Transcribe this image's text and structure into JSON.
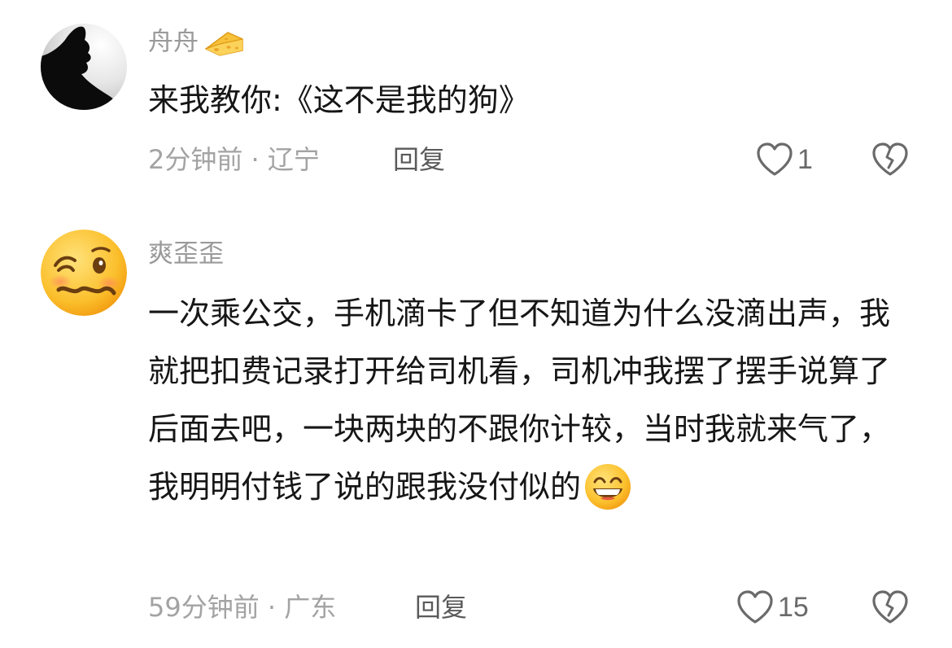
{
  "comments": [
    {
      "username": "舟舟",
      "badge_icon": "cheese-icon",
      "avatar_icon": "silhouette-avatar",
      "text": "来我教你:《这不是我的狗》",
      "meta": "2分钟前 · 辽宁",
      "reply_label": "回复",
      "like_count": "1"
    },
    {
      "username": "爽歪歪",
      "avatar_icon": "woozy-face-emoji",
      "text": "一次乘公交，手机滴卡了但不知道为什么没滴出声，我就把扣费记录打开给司机看，司机冲我摆了摆手说算了后面去吧，一块两块的不跟你计较，当时我就来气了，我明明付钱了说的跟我没付似的",
      "text_emoji": "grinning-face-emoji",
      "meta": "59分钟前 · 广东",
      "reply_label": "回复",
      "like_count": "15"
    }
  ],
  "colors": {
    "text": "#161616",
    "username": "#9a9a9a",
    "meta": "#a3a3a3",
    "reply": "#5a5a5a",
    "icon": "#6a6a6a"
  }
}
